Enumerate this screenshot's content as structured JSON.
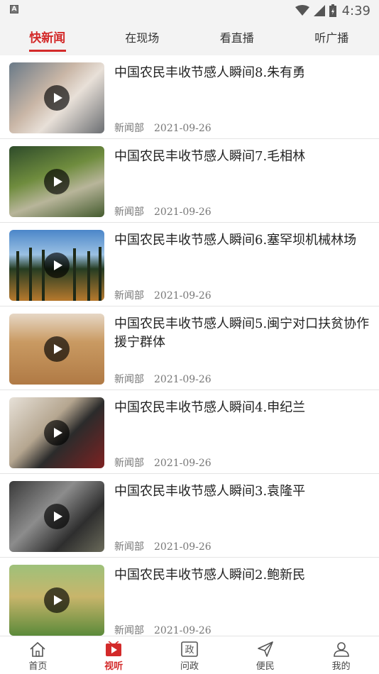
{
  "status_bar": {
    "time": "4:39",
    "left_icon": "A"
  },
  "top_tabs": [
    {
      "label": "快新闻",
      "active": true
    },
    {
      "label": "在现场",
      "active": false
    },
    {
      "label": "看直播",
      "active": false
    },
    {
      "label": "听广播",
      "active": false
    }
  ],
  "news": [
    {
      "title": "中国农民丰收节感人瞬间8.朱有勇",
      "source": "新闻部",
      "date": "2021-09-26"
    },
    {
      "title": "中国农民丰收节感人瞬间7.毛相林",
      "source": "新闻部",
      "date": "2021-09-26"
    },
    {
      "title": "中国农民丰收节感人瞬间6.塞罕坝机械林场",
      "source": "新闻部",
      "date": "2021-09-26"
    },
    {
      "title": "中国农民丰收节感人瞬间5.闽宁对口扶贫协作援宁群体",
      "source": "新闻部",
      "date": "2021-09-26"
    },
    {
      "title": "中国农民丰收节感人瞬间4.申纪兰",
      "source": "新闻部",
      "date": "2021-09-26"
    },
    {
      "title": "中国农民丰收节感人瞬间3.袁隆平",
      "source": "新闻部",
      "date": "2021-09-26"
    },
    {
      "title": "中国农民丰收节感人瞬间2.鲍新民",
      "source": "新闻部",
      "date": "2021-09-26"
    }
  ],
  "bottom_nav": [
    {
      "label": "首页",
      "icon": "home-icon",
      "active": false
    },
    {
      "label": "视听",
      "icon": "video-icon",
      "active": true
    },
    {
      "label": "问政",
      "icon": "politics-icon",
      "active": false
    },
    {
      "label": "便民",
      "icon": "send-icon",
      "active": false
    },
    {
      "label": "我的",
      "icon": "user-icon",
      "active": false
    }
  ],
  "colors": {
    "accent": "#d32a2a"
  }
}
